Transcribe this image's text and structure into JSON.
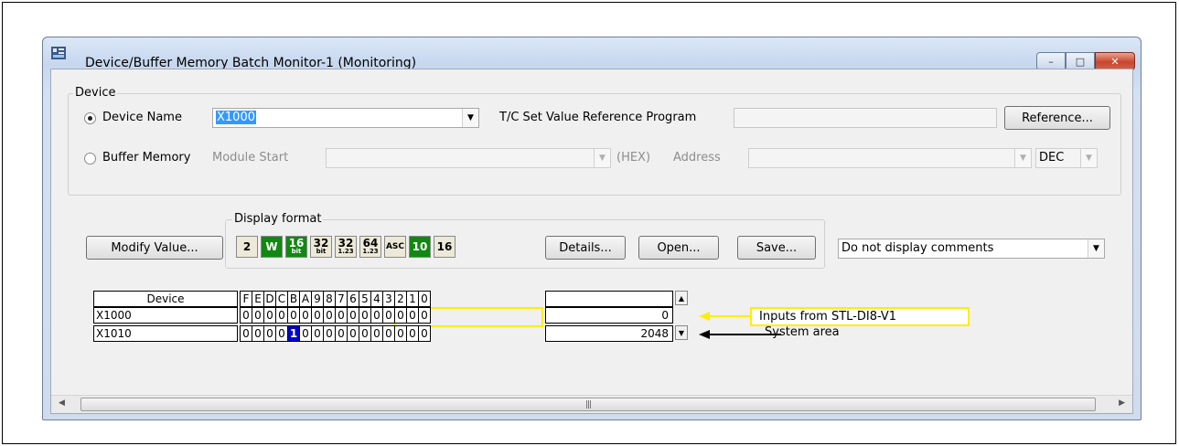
{
  "window": {
    "title": "Device/Buffer Memory Batch Monitor-1 (Monitoring)",
    "minimize_glyph": "–",
    "maximize_glyph": "□",
    "close_glyph": "✕"
  },
  "device_group": {
    "label": "Device",
    "device_name_label": "Device Name",
    "device_name_value": "X1000",
    "tc_label": "T/C Set Value Reference Program",
    "tc_value": "",
    "reference_button": "Reference...",
    "buffer_memory_label": "Buffer Memory",
    "module_start_label": "Module Start",
    "module_start_value": "",
    "hex_label": "(HEX)",
    "address_label": "Address",
    "address_value": "",
    "radix_value": "DEC",
    "selected_option": "Device Name"
  },
  "display_format": {
    "label": "Display format",
    "buttons": [
      {
        "label": "2"
      },
      {
        "label": "W"
      },
      {
        "label": "16",
        "sub": "bit"
      },
      {
        "label": "32",
        "sub": "bit"
      },
      {
        "label": "32",
        "sub": "1.23"
      },
      {
        "label": "64",
        "sub": "1.23"
      },
      {
        "label": "ASC"
      },
      {
        "label": "10"
      },
      {
        "label": "16"
      }
    ]
  },
  "toolbar": {
    "modify_value": "Modify Value...",
    "details": "Details...",
    "open": "Open...",
    "save": "Save...",
    "comment_mode": "Do not display comments"
  },
  "grid": {
    "device_header": "Device",
    "bit_headers": [
      "F",
      "E",
      "D",
      "C",
      "B",
      "A",
      "9",
      "8",
      "7",
      "6",
      "5",
      "4",
      "3",
      "2",
      "1",
      "0"
    ],
    "rows": [
      {
        "device": "X1000",
        "bits": [
          "0",
          "0",
          "0",
          "0",
          "0",
          "0",
          "0",
          "0",
          "0",
          "0",
          "0",
          "0",
          "0",
          "0",
          "0",
          "0"
        ],
        "value": "0"
      },
      {
        "device": "X1010",
        "bits": [
          "0",
          "0",
          "0",
          "0",
          "1",
          "0",
          "0",
          "0",
          "0",
          "0",
          "0",
          "0",
          "0",
          "0",
          "0",
          "0"
        ],
        "value": "2048"
      }
    ]
  },
  "annotations": {
    "inputs": "Inputs from STL-DI8-V1",
    "system": "System area"
  },
  "colors": {
    "highlight": "#ffee00",
    "bit_on": "#0000cc",
    "format_green": "#118811"
  }
}
